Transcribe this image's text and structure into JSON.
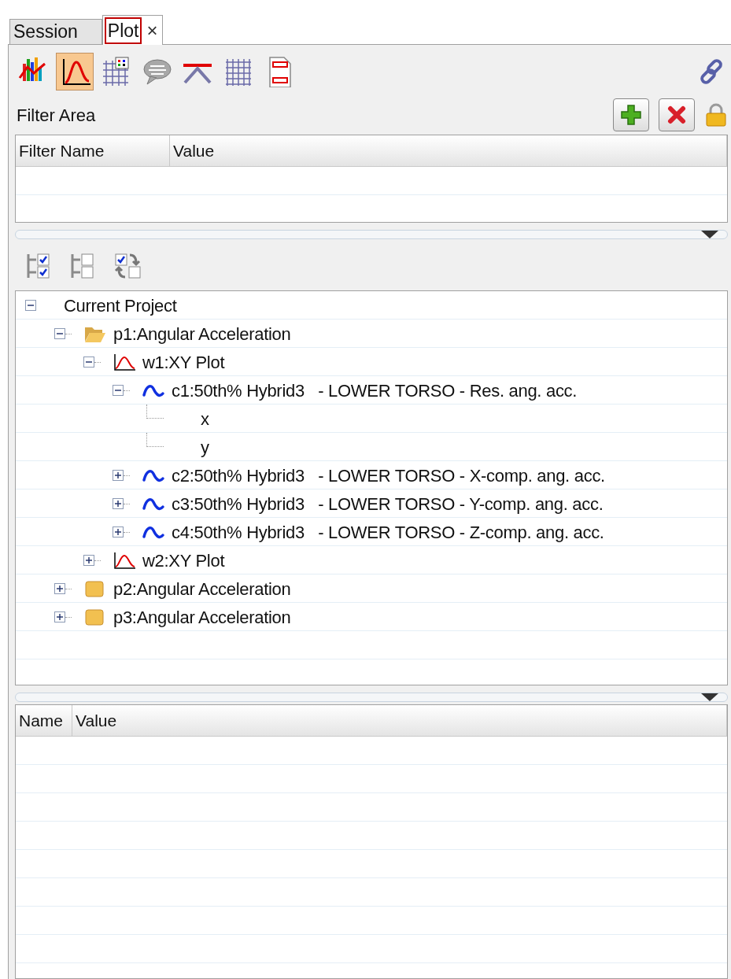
{
  "tabs": [
    {
      "label": "Session",
      "selected": false
    },
    {
      "label": "Plot",
      "selected": true,
      "close": "×"
    }
  ],
  "toolbar": [
    {
      "kind": "bars",
      "selected": false
    },
    {
      "kind": "curve",
      "selected": true
    },
    {
      "kind": "legend",
      "selected": false
    },
    {
      "kind": "note",
      "selected": false
    },
    {
      "kind": "datum",
      "selected": false
    },
    {
      "kind": "grid",
      "selected": false
    },
    {
      "kind": "page",
      "selected": false
    }
  ],
  "filter_area": {
    "title": "Filter Area",
    "columns": [
      "Filter Name",
      "Value"
    ]
  },
  "tree": [
    {
      "label": "Current Project",
      "expanded": true,
      "children": [
        {
          "label": "p1:Angular Acceleration",
          "kind": "page",
          "expanded": true,
          "children": [
            {
              "label": "w1:XY Plot",
              "kind": "window",
              "expanded": true,
              "children": [
                {
                  "label": "c1:50th% Hybrid3   - LOWER TORSO - Res. ang. acc.",
                  "kind": "curve",
                  "expanded": true,
                  "children": [
                    {
                      "label": "x"
                    },
                    {
                      "label": "y"
                    }
                  ]
                },
                {
                  "label": "c2:50th% Hybrid3   - LOWER TORSO - X-comp. ang. acc.",
                  "kind": "curve",
                  "expanded": false
                },
                {
                  "label": "c3:50th% Hybrid3   - LOWER TORSO - Y-comp. ang. acc.",
                  "kind": "curve",
                  "expanded": false
                },
                {
                  "label": "c4:50th% Hybrid3   - LOWER TORSO - Z-comp. ang. acc.",
                  "kind": "curve",
                  "expanded": false
                }
              ]
            },
            {
              "label": "w2:XY Plot",
              "kind": "window",
              "expanded": false
            }
          ]
        },
        {
          "label": "p2:Angular Acceleration",
          "kind": "page",
          "expanded": false
        },
        {
          "label": "p3:Angular Acceleration",
          "kind": "page",
          "expanded": false
        }
      ]
    }
  ],
  "properties": {
    "columns": [
      "Name",
      "Value"
    ]
  }
}
